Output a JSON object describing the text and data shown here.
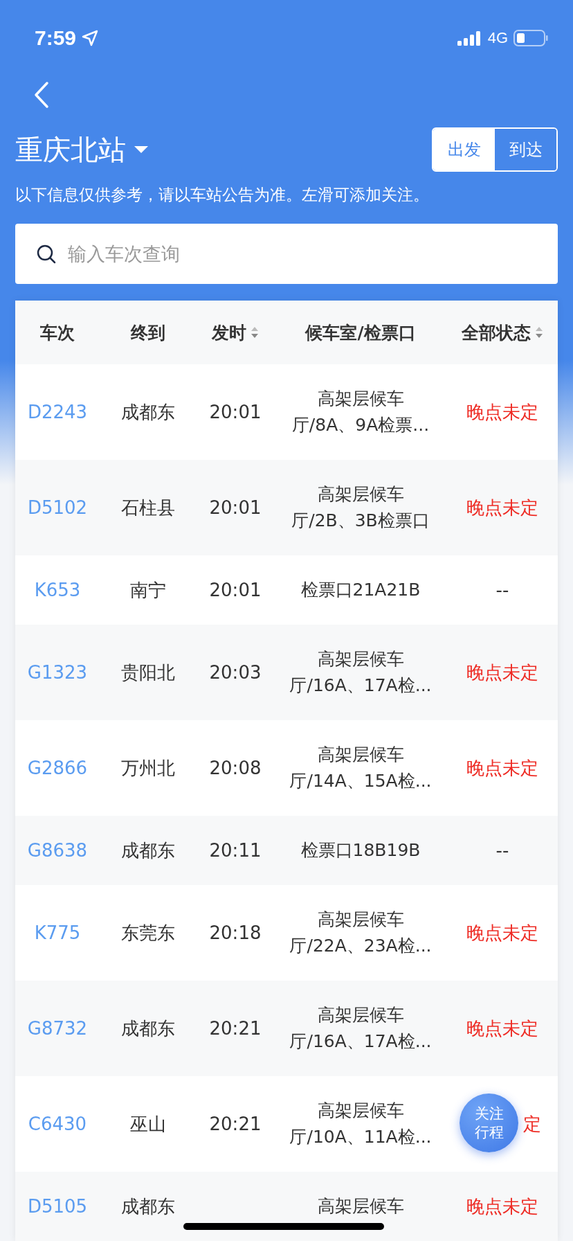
{
  "status_bar": {
    "time": "7:59",
    "network": "4G"
  },
  "header": {
    "station": "重庆北站",
    "modes": [
      {
        "label": "出发",
        "selected": true
      },
      {
        "label": "到达",
        "selected": false
      }
    ],
    "notice": "以下信息仅供参考，请以车站公告为准。左滑可添加关注。"
  },
  "search": {
    "placeholder": "输入车次查询"
  },
  "table": {
    "columns": [
      {
        "label": "车次",
        "sortable": false
      },
      {
        "label": "终到",
        "sortable": false
      },
      {
        "label": "发时",
        "sortable": true
      },
      {
        "label": "候车室/检票口",
        "sortable": false
      },
      {
        "label": "全部状态",
        "sortable": true
      }
    ],
    "rows": [
      {
        "train": "D2243",
        "terminal": "成都东",
        "time": "20:01",
        "gate": [
          "高架层候车",
          "厅/8A、9A检票..."
        ],
        "status": "晚点未定",
        "kind": "late"
      },
      {
        "train": "D5102",
        "terminal": "石柱县",
        "time": "20:01",
        "gate": [
          "高架层候车",
          "厅/2B、3B检票口"
        ],
        "status": "晚点未定",
        "kind": "late"
      },
      {
        "train": "K653",
        "terminal": "南宁",
        "time": "20:01",
        "gate": [
          "检票口21A21B"
        ],
        "status": "--",
        "kind": "none"
      },
      {
        "train": "G1323",
        "terminal": "贵阳北",
        "time": "20:03",
        "gate": [
          "高架层候车",
          "厅/16A、17A检..."
        ],
        "status": "晚点未定",
        "kind": "late"
      },
      {
        "train": "G2866",
        "terminal": "万州北",
        "time": "20:08",
        "gate": [
          "高架层候车",
          "厅/14A、15A检..."
        ],
        "status": "晚点未定",
        "kind": "late"
      },
      {
        "train": "G8638",
        "terminal": "成都东",
        "time": "20:11",
        "gate": [
          "检票口18B19B"
        ],
        "status": "--",
        "kind": "none"
      },
      {
        "train": "K775",
        "terminal": "东莞东",
        "time": "20:18",
        "gate": [
          "高架层候车",
          "厅/22A、23A检..."
        ],
        "status": "晚点未定",
        "kind": "late"
      },
      {
        "train": "G8732",
        "terminal": "成都东",
        "time": "20:21",
        "gate": [
          "高架层候车",
          "厅/16A、17A检..."
        ],
        "status": "晚点未定",
        "kind": "late"
      },
      {
        "train": "C6430",
        "terminal": "巫山",
        "time": "20:21",
        "gate": [
          "高架层候车",
          "厅/10A、11A检..."
        ],
        "status": "定",
        "kind": "late_partial"
      },
      {
        "train": "D5105",
        "terminal": "成都东",
        "gate": [
          "高架层候车"
        ],
        "status": "晚点未定",
        "kind": "late"
      }
    ]
  },
  "follow_button": {
    "label": "关注行程"
  }
}
